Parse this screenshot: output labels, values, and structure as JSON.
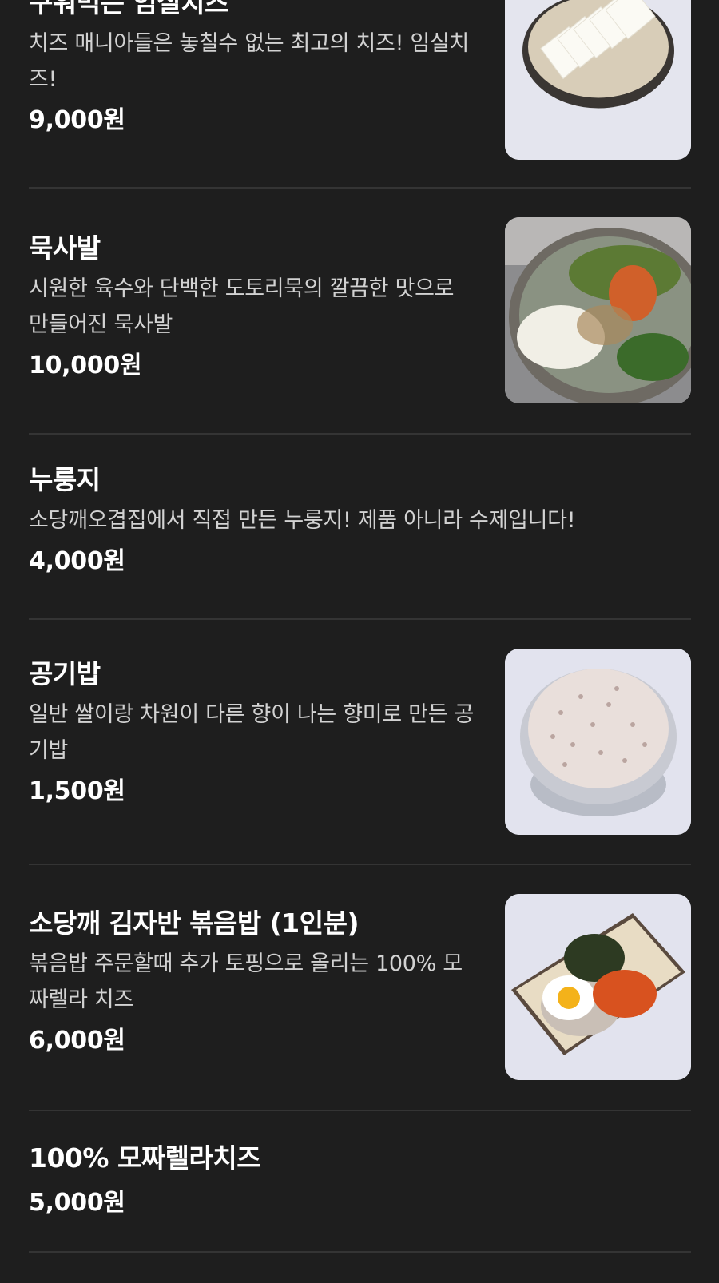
{
  "menu": {
    "items": [
      {
        "name": "구워먹는 임실치즈",
        "description": "치즈 매니아들은 놓칠수 없는 최고의 치즈! 임실치즈!",
        "price": "9,000원",
        "image": "grilled-imsil-cheese-photo"
      },
      {
        "name": "묵사발",
        "description": "시원한 육수와 단백한 도토리묵의 깔끔한 맛으로 만들어진 묵사발",
        "price": "10,000원",
        "image": "muksabal-photo"
      },
      {
        "name": "누룽지",
        "description": "소당깨오겹집에서 직접 만든 누룽지! 제품 아니라 수제입니다!",
        "price": "4,000원"
      },
      {
        "name": "공기밥",
        "description": "일반 쌀이랑 차원이 다른 향이 나는 향미로 만든 공기밥",
        "price": "1,500원",
        "image": "rice-bowl-photo"
      },
      {
        "name": "소당깨 김자반 볶음밥 (1인분)",
        "description": "볶음밥 주문할때 추가 토핑으로 올리는 100% 모짜렐라 치즈",
        "price": "6,000원",
        "image": "fried-rice-photo"
      },
      {
        "name": "100% 모짜렐라치즈",
        "price": "5,000원"
      }
    ]
  }
}
